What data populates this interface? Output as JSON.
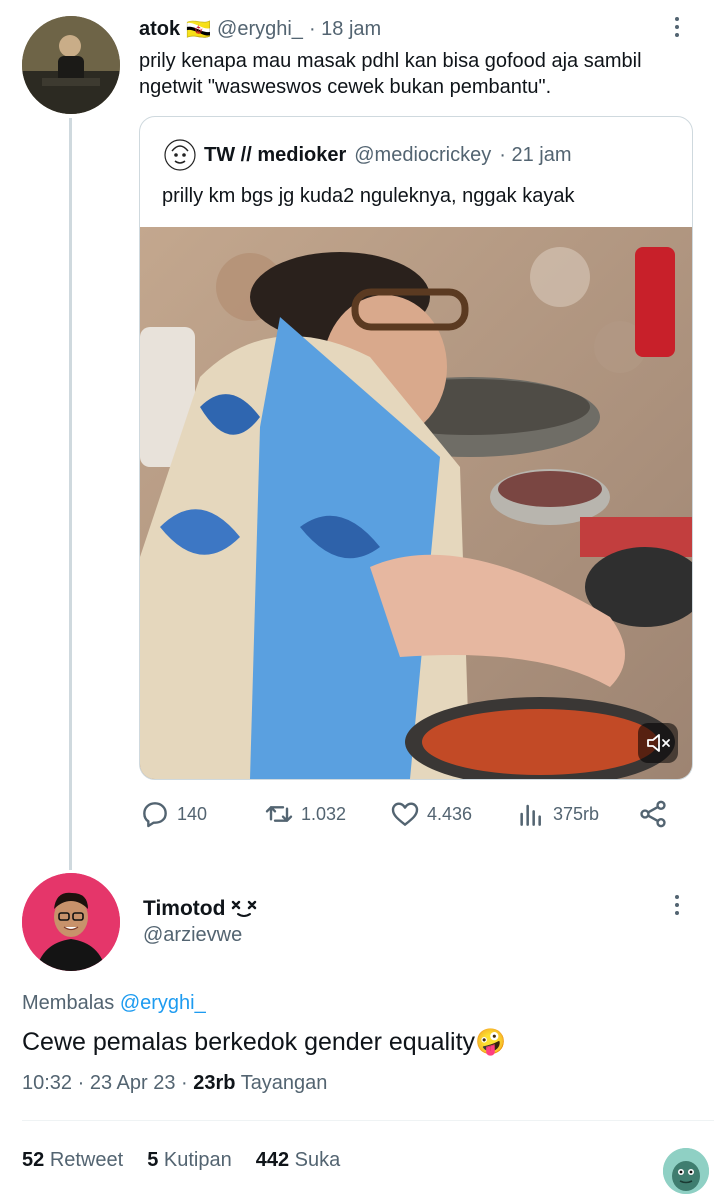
{
  "tweet": {
    "author_name": "atok",
    "flag": "🇧🇳",
    "handle": "@eryghi_",
    "time": "· 18 jam",
    "text": "prily kenapa mau masak pdhl kan bisa gofood aja sambil ngetwit \"wasweswos cewek bukan pembantu\".",
    "icons": {
      "more": "more-vertical-icon",
      "avatar": "profile-photo"
    }
  },
  "quote": {
    "author_name": "TW // medioker",
    "handle": "@mediocrickey",
    "time": "· 21 jam",
    "text": "prilly km bgs jg kuda2 nguleknya, nggak kayak",
    "media_icon": "mute-icon"
  },
  "actions": {
    "reply_count": "140",
    "retweet_count": "1.032",
    "like_count": "4.436",
    "views_count": "375rb"
  },
  "reply": {
    "author_name": "Timotod",
    "badge": "xx",
    "handle": "@arzievwe",
    "replying_prefix": "Membalas",
    "replying_handle": "@eryghi_",
    "text": "Cewe pemalas berkedok gender equality",
    "emoji": "🤪",
    "time": "10:32 · 23 Apr 23 ·",
    "views_count": "23rb",
    "views_label": "Tayangan",
    "retweets_count": "52",
    "retweets_label": "Retweet",
    "quotes_count": "5",
    "quotes_label": "Kutipan",
    "likes_count": "442",
    "likes_label": "Suka"
  },
  "colors": {
    "link": "#1d9bf0",
    "muted": "#536471",
    "border": "#cfd9de"
  }
}
